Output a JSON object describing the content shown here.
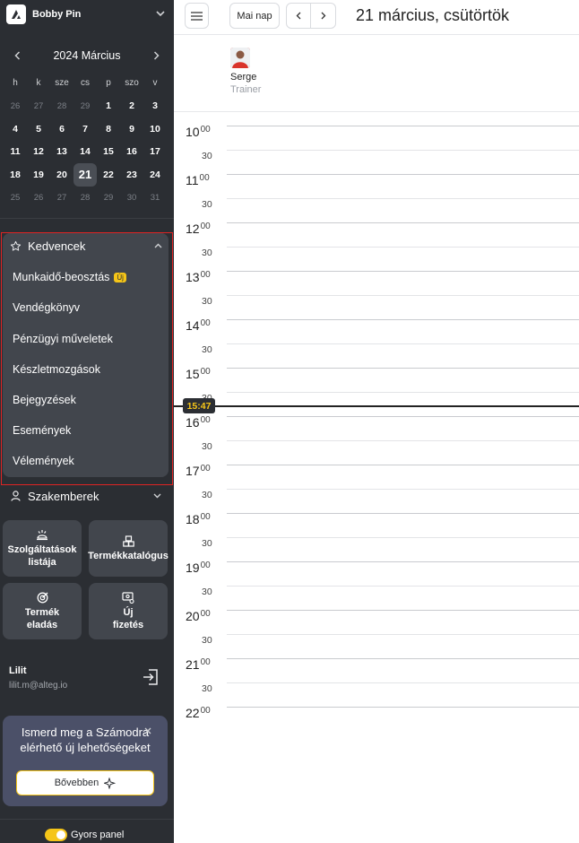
{
  "account": {
    "name": "Bobby Pin"
  },
  "mini_calendar": {
    "month_title": "2024 Március",
    "weekdays": [
      "h",
      "k",
      "sze",
      "cs",
      "p",
      "szo",
      "v"
    ],
    "weeks": [
      [
        {
          "d": "26",
          "m": 1
        },
        {
          "d": "27",
          "m": 1
        },
        {
          "d": "28",
          "m": 1
        },
        {
          "d": "29",
          "m": 1
        },
        {
          "d": "1"
        },
        {
          "d": "2"
        },
        {
          "d": "3"
        }
      ],
      [
        {
          "d": "4"
        },
        {
          "d": "5"
        },
        {
          "d": "6"
        },
        {
          "d": "7"
        },
        {
          "d": "8"
        },
        {
          "d": "9"
        },
        {
          "d": "10"
        }
      ],
      [
        {
          "d": "11"
        },
        {
          "d": "12"
        },
        {
          "d": "13"
        },
        {
          "d": "14"
        },
        {
          "d": "15"
        },
        {
          "d": "16"
        },
        {
          "d": "17"
        }
      ],
      [
        {
          "d": "18"
        },
        {
          "d": "19"
        },
        {
          "d": "20"
        },
        {
          "d": "21",
          "t": 1
        },
        {
          "d": "22"
        },
        {
          "d": "23"
        },
        {
          "d": "24"
        }
      ],
      [
        {
          "d": "25",
          "m": 1
        },
        {
          "d": "26",
          "m": 1
        },
        {
          "d": "27",
          "m": 1
        },
        {
          "d": "28",
          "m": 1
        },
        {
          "d": "29",
          "m": 1
        },
        {
          "d": "30",
          "m": 1
        },
        {
          "d": "31",
          "m": 1
        }
      ]
    ]
  },
  "favorites": {
    "title": "Kedvencek",
    "items": [
      "Munkaidő-beosztás",
      "Vendégkönyv",
      "Pénzügyi műveletek",
      "Készletmozgások",
      "Bejegyzések",
      "Események",
      "Vélemények"
    ],
    "new_badge": "Új"
  },
  "specialists": {
    "title": "Szakemberek"
  },
  "tiles": {
    "services": "Szolgáltatások listája",
    "catalog": "Termékkatalógus",
    "product_sale": "Termék eladás",
    "new_payment": "Új fizetés"
  },
  "user": {
    "name": "Lilit",
    "email": "lilit.m@alteg.io"
  },
  "promo": {
    "text": "Ismerd meg a Számodra elérhető új lehetőségeket",
    "button": "Bővebben"
  },
  "quick_panel": {
    "label": "Gyors panel",
    "on": true
  },
  "header": {
    "today_button": "Mai nap",
    "date_title": "21 március, csütörtök"
  },
  "staff": {
    "name": "Serge",
    "role": "Trainer"
  },
  "schedule": {
    "hours": [
      "10",
      "11",
      "12",
      "13",
      "14",
      "15",
      "16",
      "17",
      "18",
      "19",
      "20",
      "21",
      "22"
    ],
    "minute_label": "00",
    "half_label": "30",
    "current_time": "15:47"
  },
  "colors": {
    "sidebar_bg": "#2b2e33",
    "panel_bg": "#42464d",
    "accent": "#f5c518",
    "highlight": "#e02424"
  }
}
